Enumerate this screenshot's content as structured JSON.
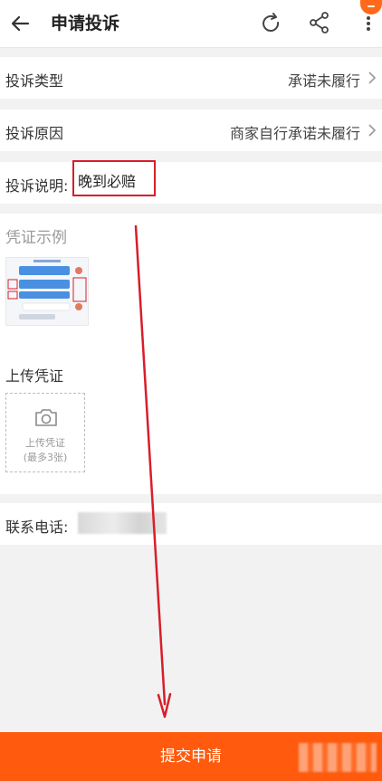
{
  "header": {
    "title": "申请投诉"
  },
  "form": {
    "type_label": "投诉类型",
    "type_value": "承诺未履行",
    "reason_label": "投诉原因",
    "reason_value": "商家自行承诺未履行",
    "desc_label": "投诉说明:",
    "desc_value": "晚到必赔"
  },
  "evidence": {
    "sample_title": "凭证示例",
    "upload_title": "上传凭证",
    "upload_label": "上传凭证",
    "upload_limit": "(最多3张)"
  },
  "contact": {
    "phone_label": "联系电话:"
  },
  "footer": {
    "submit_label": "提交申请"
  },
  "colors": {
    "accent": "#ff5a0d",
    "highlight_border": "#d81e2a",
    "annotation_arrow": "#d81e2a"
  }
}
